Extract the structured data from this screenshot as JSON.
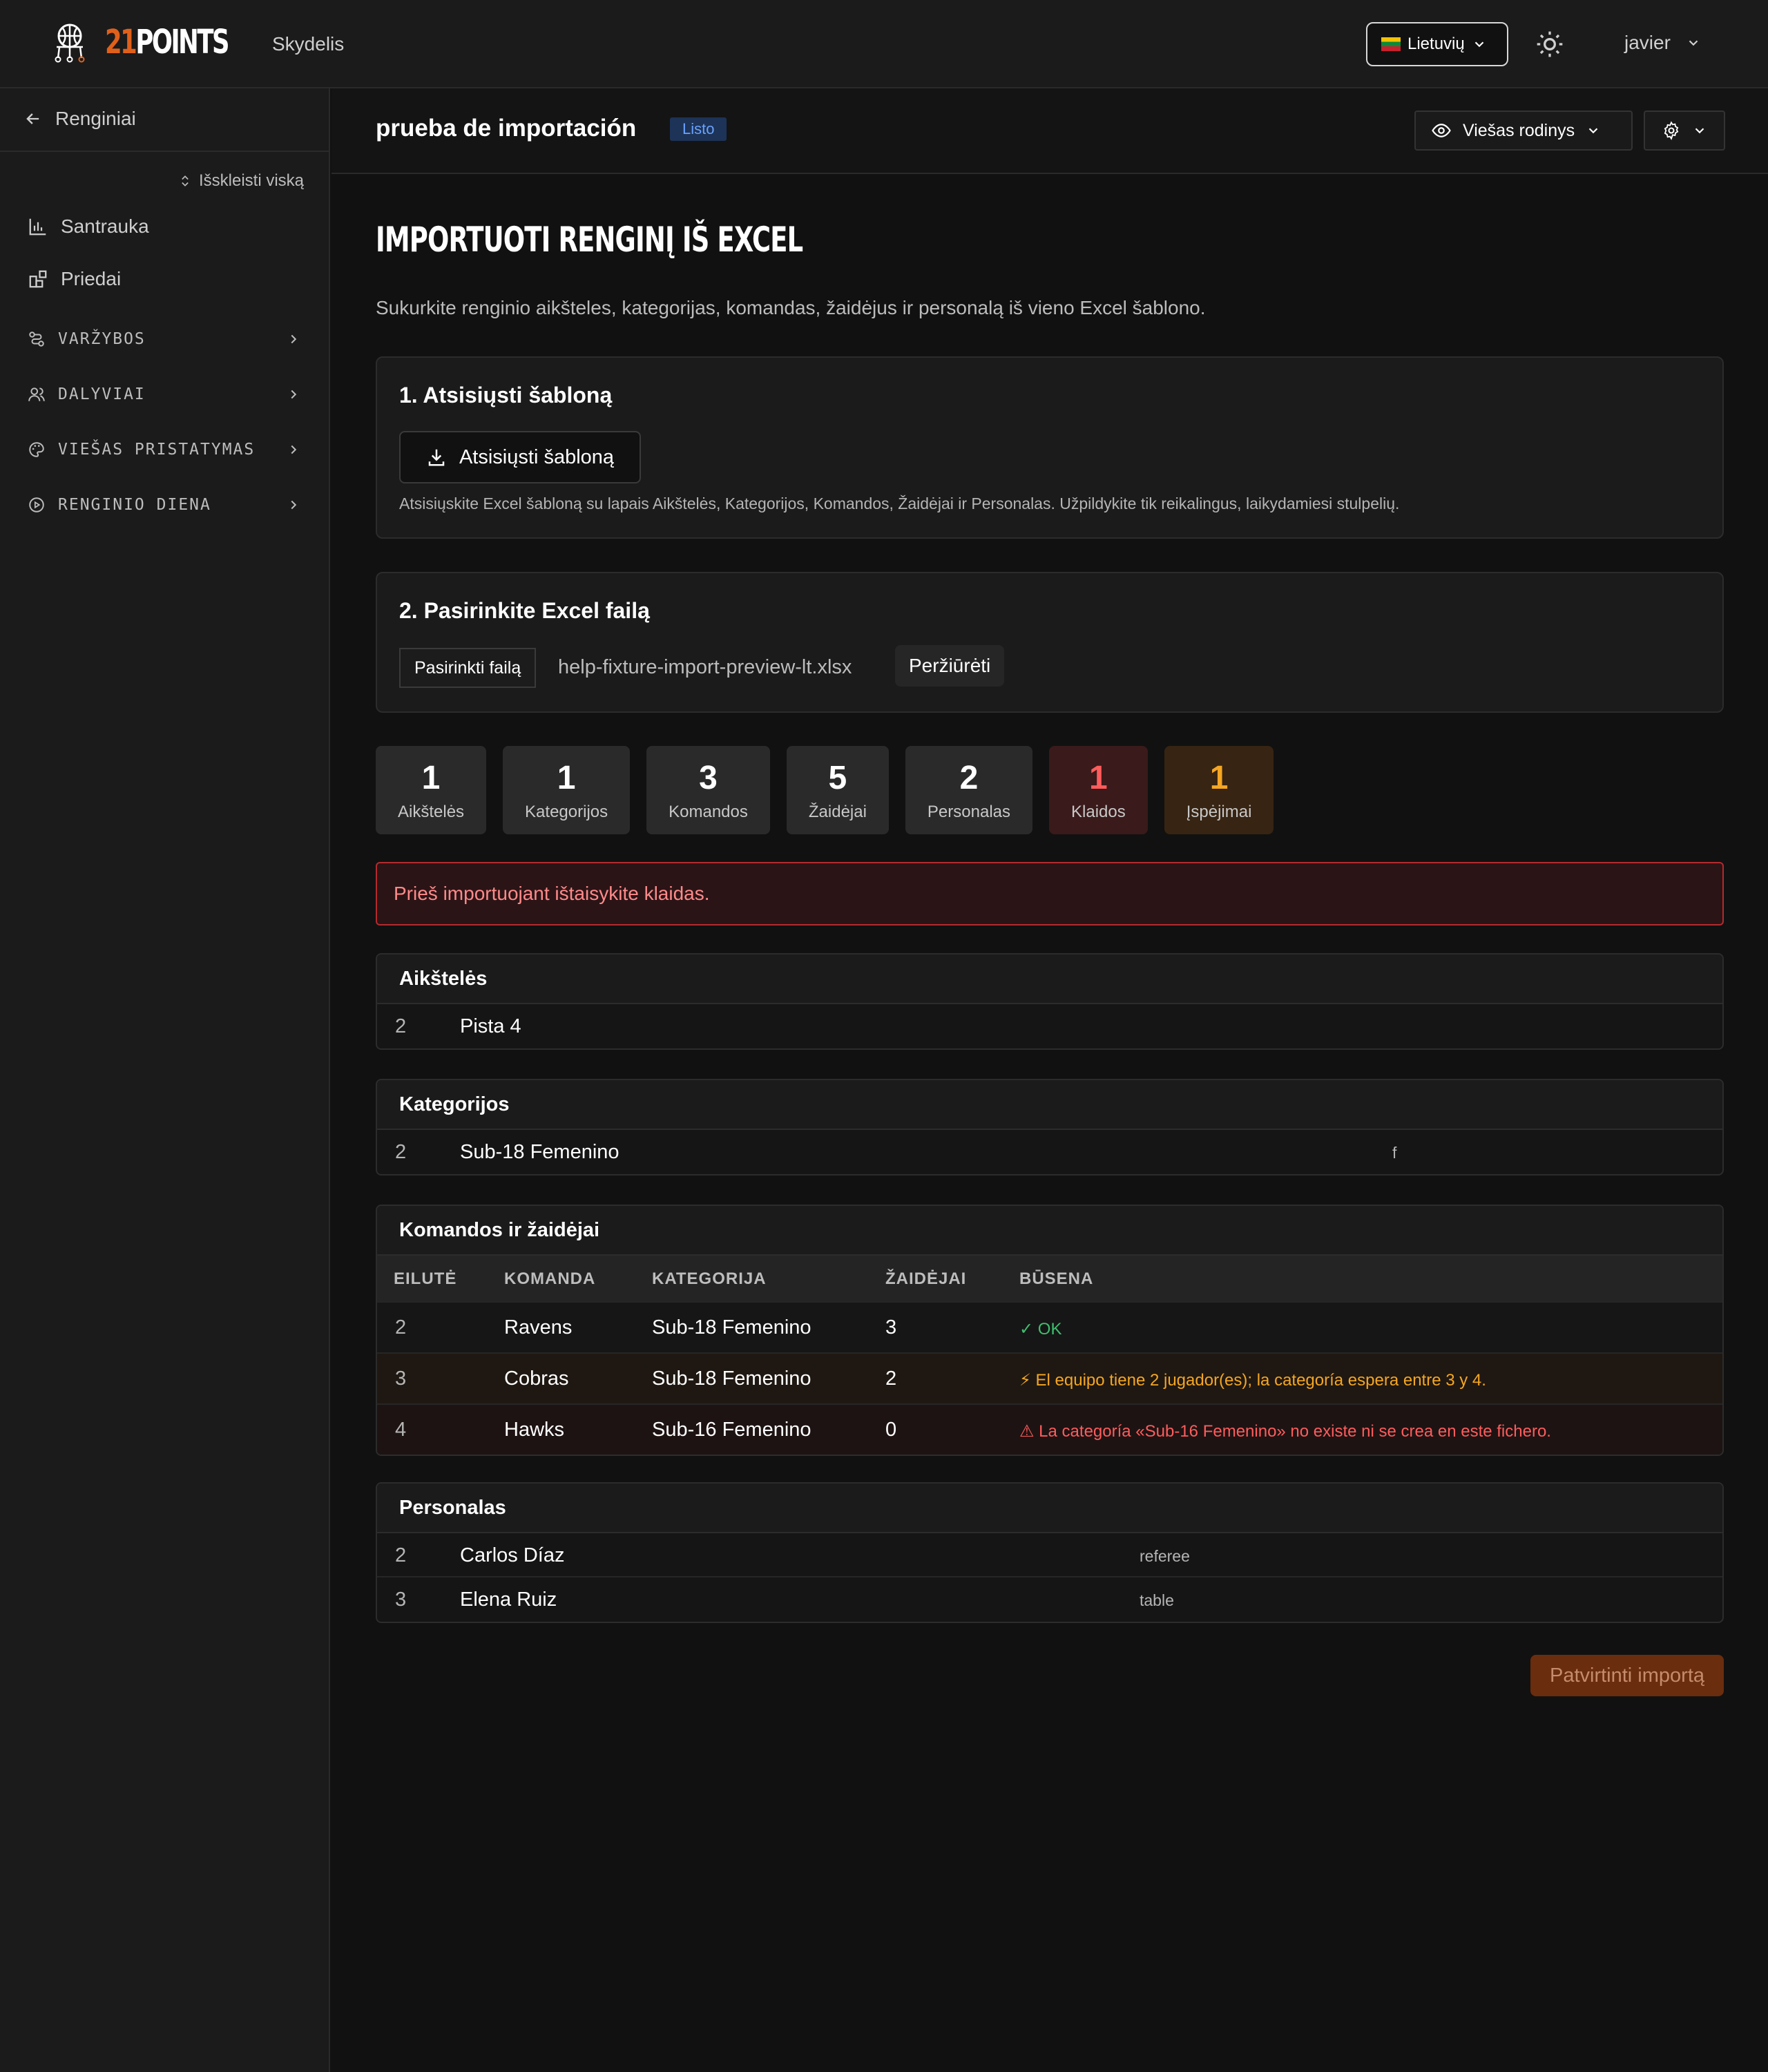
{
  "topbar": {
    "logo_text_a": "21",
    "logo_text_b": "POINTS",
    "nav_dashboard": "Skydelis",
    "language": "Lietuvių",
    "user": "javier"
  },
  "sidebar": {
    "back_label": "Renginiai",
    "expand_all": "Išskleisti viską",
    "items": [
      {
        "label": "Santrauka",
        "icon": "bar-chart-icon"
      },
      {
        "label": "Priedai",
        "icon": "addons-icon"
      }
    ],
    "groups": [
      {
        "label": "VARŽYBOS",
        "icon": "route-icon"
      },
      {
        "label": "DALYVIAI",
        "icon": "users-icon"
      },
      {
        "label": "VIEŠAS PRISTATYMAS",
        "icon": "palette-icon"
      },
      {
        "label": "RENGINIO DIENA",
        "icon": "play-circle-icon"
      }
    ]
  },
  "header": {
    "event_title": "prueba de importación",
    "status_badge": "Listo",
    "public_view": "Viešas rodinys"
  },
  "main": {
    "title": "IMPORTUOTI RENGINĮ IŠ EXCEL",
    "subtitle": "Sukurkite renginio aikšteles, kategorijas, komandas, žaidėjus ir personalą iš vieno Excel šablono.",
    "step1": {
      "title": "1. Atsisiųsti šabloną",
      "button": "Atsisiųsti šabloną",
      "hint": "Atsisiųskite Excel šabloną su lapais Aikštelės, Kategorijos, Komandos, Žaidėjai ir Personalas. Užpildykite tik reikalingus, laikydamiesi stulpelių."
    },
    "step2": {
      "title": "2. Pasirinkite Excel failą",
      "choose_button": "Pasirinkti failą",
      "file_name": "help-fixture-import-preview-lt.xlsx",
      "preview_button": "Peržiūrėti"
    },
    "stats": [
      {
        "value": "1",
        "label": "Aikštelės",
        "kind": "normal"
      },
      {
        "value": "1",
        "label": "Kategorijos",
        "kind": "normal"
      },
      {
        "value": "3",
        "label": "Komandos",
        "kind": "normal"
      },
      {
        "value": "5",
        "label": "Žaidėjai",
        "kind": "normal"
      },
      {
        "value": "2",
        "label": "Personalas",
        "kind": "normal"
      },
      {
        "value": "1",
        "label": "Klaidos",
        "kind": "error"
      },
      {
        "value": "1",
        "label": "Įspėjimai",
        "kind": "warning"
      }
    ],
    "alert": "Prieš importuojant ištaisykite klaidas.",
    "courts": {
      "title": "Aikštelės",
      "rows": [
        {
          "row": "2",
          "name": "Pista 4"
        }
      ]
    },
    "categories": {
      "title": "Kategorijos",
      "rows": [
        {
          "row": "2",
          "name": "Sub-18 Femenino",
          "gender": "f"
        }
      ]
    },
    "teams": {
      "title": "Komandos ir žaidėjai",
      "headers": [
        "EILUTĖ",
        "KOMANDA",
        "KATEGORIJA",
        "ŽAIDĖJAI",
        "BŪSENA"
      ],
      "rows": [
        {
          "row": "2",
          "team": "Ravens",
          "category": "Sub-18 Femenino",
          "players": "3",
          "status": "✓ OK",
          "kind": "ok"
        },
        {
          "row": "3",
          "team": "Cobras",
          "category": "Sub-18 Femenino",
          "players": "2",
          "status": "⚡ El equipo tiene 2 jugador(es); la categoría espera entre 3 y 4.",
          "kind": "warn"
        },
        {
          "row": "4",
          "team": "Hawks",
          "category": "Sub-16 Femenino",
          "players": "0",
          "status": "⚠ La categoría «Sub-16 Femenino» no existe ni se crea en este fichero.",
          "kind": "err"
        }
      ]
    },
    "staff": {
      "title": "Personalas",
      "rows": [
        {
          "row": "2",
          "name": "Carlos Díaz",
          "role": "referee"
        },
        {
          "row": "3",
          "name": "Elena Ruiz",
          "role": "table"
        }
      ]
    },
    "confirm_button": "Patvirtinti importą"
  },
  "colors": {
    "accent": "#e0601a",
    "ok": "#3fbf6f",
    "warning": "#f5a623",
    "error": "#ff5c5c",
    "badge": "#6aa2ff"
  }
}
